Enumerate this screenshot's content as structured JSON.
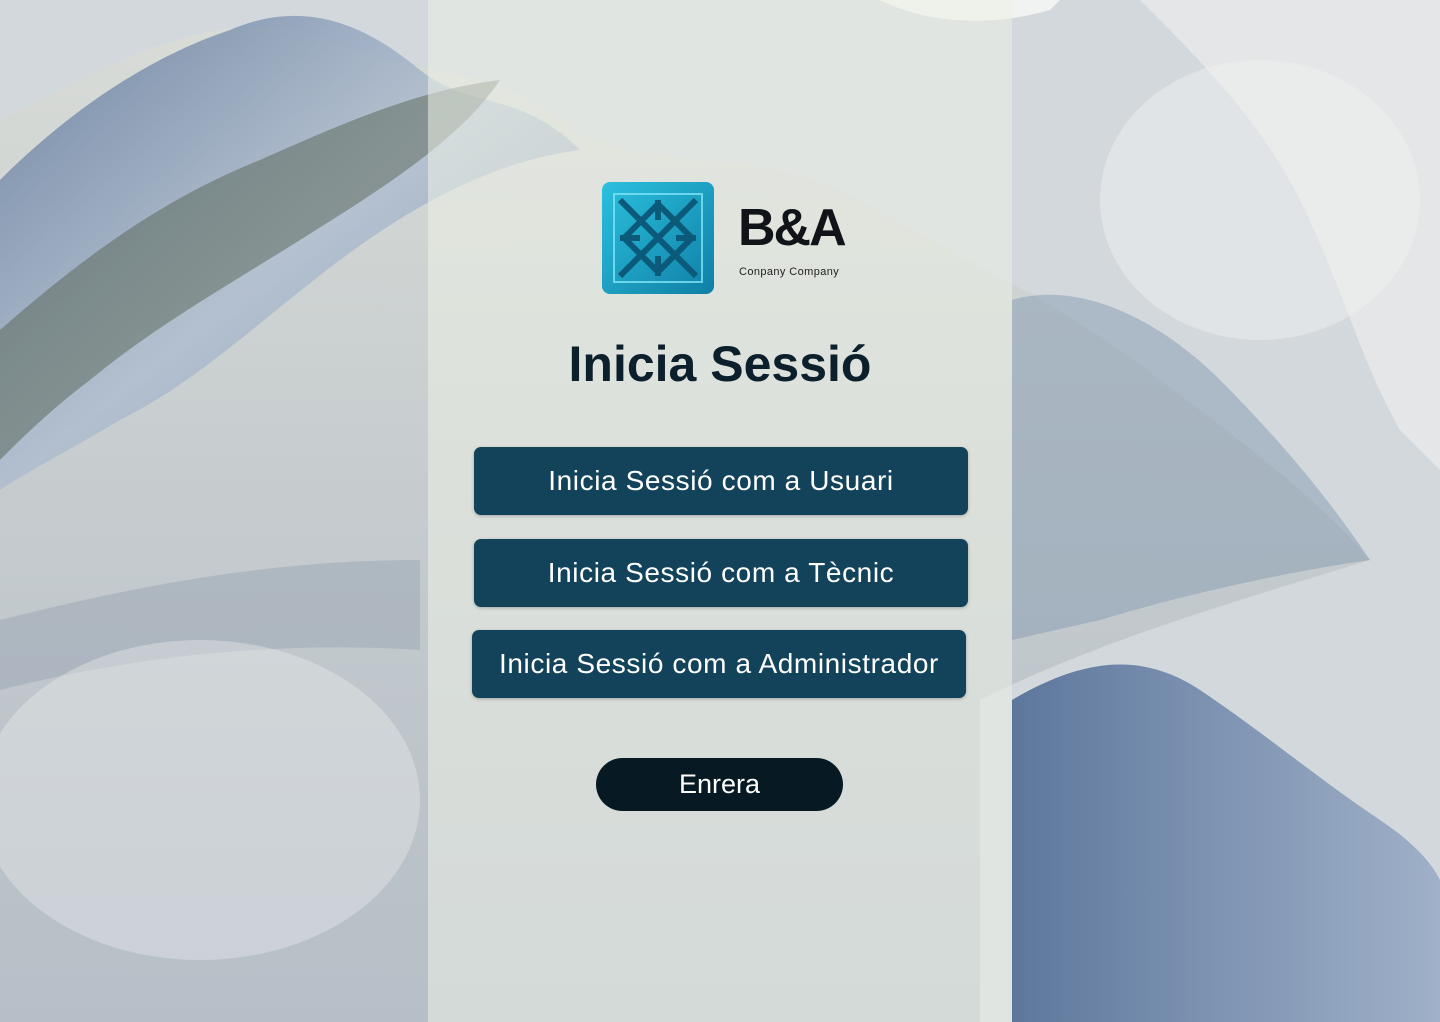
{
  "logo": {
    "brand_text": "B&A",
    "sub_text": "Conpany Company",
    "brand_color": "#1aa7c8"
  },
  "page": {
    "title": "Inicia Sessió"
  },
  "buttons": {
    "user": "Inicia Sessió com a Usuari",
    "technician": "Inicia Sessió com a Tècnic",
    "admin": "Inicia Sessió com a Administrador",
    "back": "Enrera"
  },
  "colors": {
    "primary_button": "#12435a",
    "back_button": "#071a24",
    "title": "#0c1f2c"
  }
}
